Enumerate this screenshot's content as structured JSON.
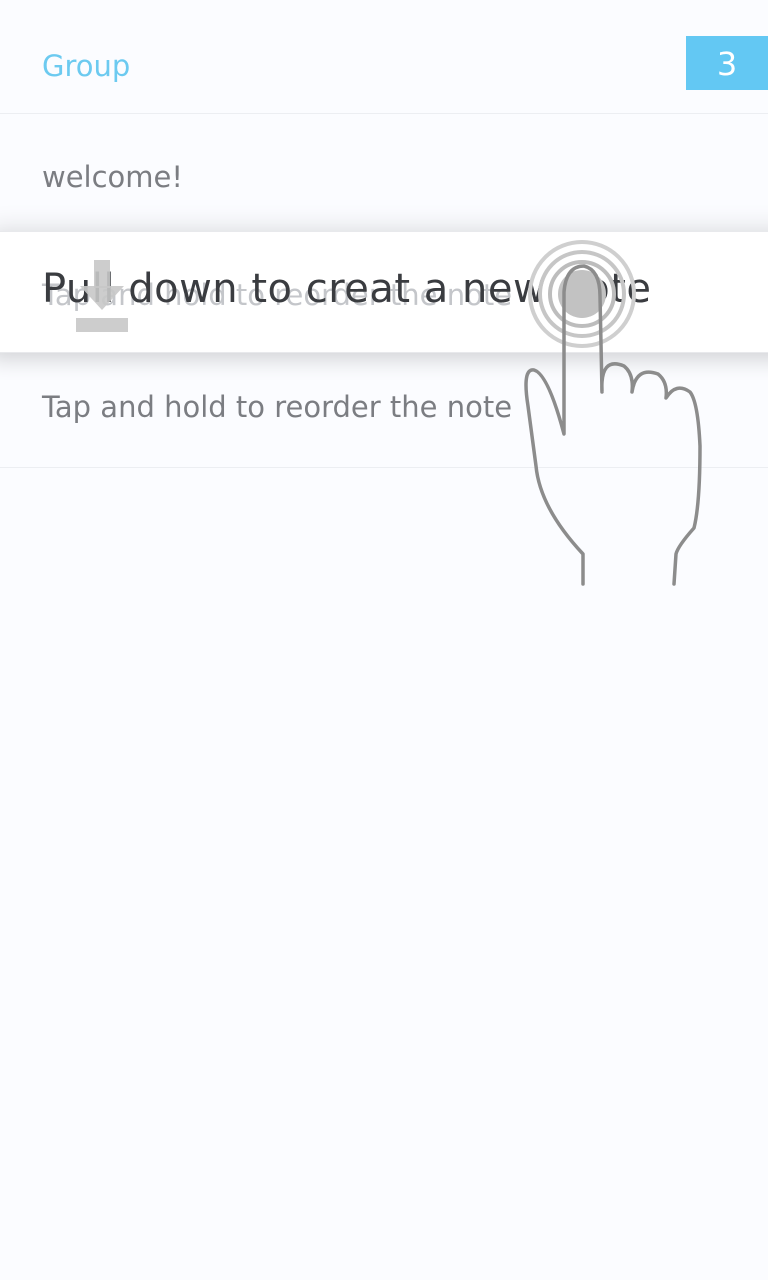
{
  "header": {
    "title": "Group",
    "count": "3"
  },
  "notes": [
    {
      "text": "welcome!"
    },
    {
      "text": "Tap and hold to reorder the note"
    },
    {
      "text": "Tap and hold to reorder the note"
    }
  ],
  "tutorial": {
    "pull_text": "Pull down to creat a new note",
    "icons": [
      "download-arrow-icon",
      "hand-gesture-icon"
    ]
  },
  "colors": {
    "accent": "#63c8f3",
    "title": "#6ccaf0",
    "background": "#fbfcff",
    "note_text": "#7b7d82"
  }
}
